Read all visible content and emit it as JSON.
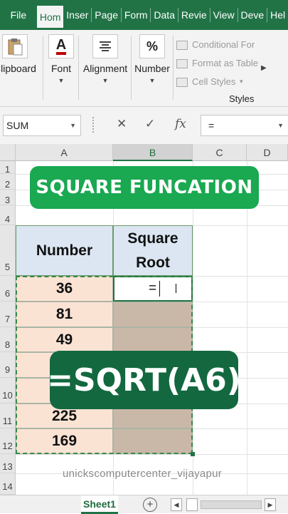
{
  "ribbon_tabs": [
    "File",
    "Hom",
    "Inser",
    "Page",
    "Form",
    "Data",
    "Revie",
    "View",
    "Deve",
    "Hel"
  ],
  "ribbon_groups": {
    "clipboard": "Clipboard",
    "font": "Font",
    "font_icon": "A",
    "alignment": "Alignment",
    "number": "Number",
    "number_icon": "%",
    "styles_items": [
      "Conditional For",
      "Format as Table",
      "Cell Styles"
    ],
    "styles_label": "Styles"
  },
  "formula_bar": {
    "name_box": "SUM",
    "cancel_icon": "✕",
    "enter_icon": "✓",
    "fx_icon": "fx",
    "content": "="
  },
  "grid": {
    "columns": [
      "A",
      "B",
      "C",
      "D"
    ],
    "rows": [
      "1",
      "2",
      "3",
      "4",
      "5",
      "6",
      "7",
      "8",
      "9",
      "10",
      "11",
      "12",
      "13",
      "14"
    ],
    "header_number": "Number",
    "header_root_line1": "Square",
    "header_root_line2": "Root",
    "numbers": [
      "36",
      "81",
      "49",
      "",
      "",
      "225",
      "169"
    ],
    "active_cell_text": "="
  },
  "overlays": {
    "banner": "SQUARE FUNCATION",
    "formula": "=SQRT(A6)",
    "watermark": "unickscomputercenter_vijayapur"
  },
  "sheet_bar": {
    "sheet_name": "Sheet1",
    "add_icon": "+"
  },
  "colors": {
    "excel_green": "#217346",
    "banner_green": "#1aa851",
    "formula_badge": "#13683f",
    "number_fill": "#fbe3d4",
    "root_fill": "#c9b8a8",
    "header_fill": "#dbe6f2"
  }
}
